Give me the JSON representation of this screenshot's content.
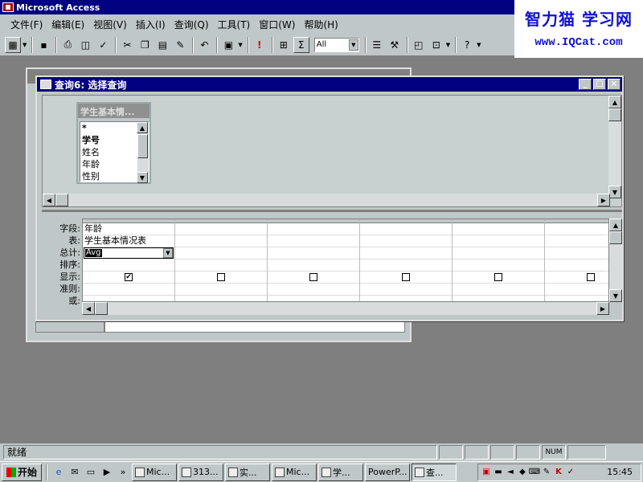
{
  "app": {
    "title": "Microsoft Access"
  },
  "watermark": {
    "line1": "智力猫 学习网",
    "line2": "www.IQCat.com"
  },
  "menu": [
    "文件(F)",
    "编辑(E)",
    "视图(V)",
    "插入(I)",
    "查询(Q)",
    "工具(T)",
    "窗口(W)",
    "帮助(H)"
  ],
  "toolbar": {
    "combo_value": "All"
  },
  "query_window": {
    "title": "查询6: 选择查询",
    "table_box": {
      "title": "学生基本情...",
      "fields": [
        {
          "label": "*",
          "bold": true
        },
        {
          "label": "学号",
          "bold": true
        },
        {
          "label": "姓名",
          "bold": false
        },
        {
          "label": "年龄",
          "bold": false
        },
        {
          "label": "性别",
          "bold": false
        }
      ]
    },
    "grid": {
      "row_labels": [
        "字段:",
        "表:",
        "总计:",
        "排序:",
        "显示:",
        "准则:",
        "或:"
      ],
      "col1": {
        "field": "年龄",
        "table": "学生基本情况表",
        "total": "Avg",
        "show": true
      },
      "empty_cols": [
        {
          "show": false
        },
        {
          "show": false
        },
        {
          "show": false
        },
        {
          "show": false
        },
        {
          "show": false
        }
      ],
      "check_glyph": "✔"
    }
  },
  "status": {
    "text": "就绪",
    "num": "NUM"
  },
  "taskbar": {
    "start": "开始",
    "buttons": [
      {
        "label": "Mic...",
        "active": false
      },
      {
        "label": "313...",
        "active": false
      },
      {
        "label": "实...",
        "active": false
      },
      {
        "label": "Mic...",
        "active": false
      },
      {
        "label": "学...",
        "active": false
      },
      {
        "label": "PowerP...",
        "active": false
      },
      {
        "label": "查...",
        "active": true
      }
    ],
    "clock": "15:45"
  }
}
